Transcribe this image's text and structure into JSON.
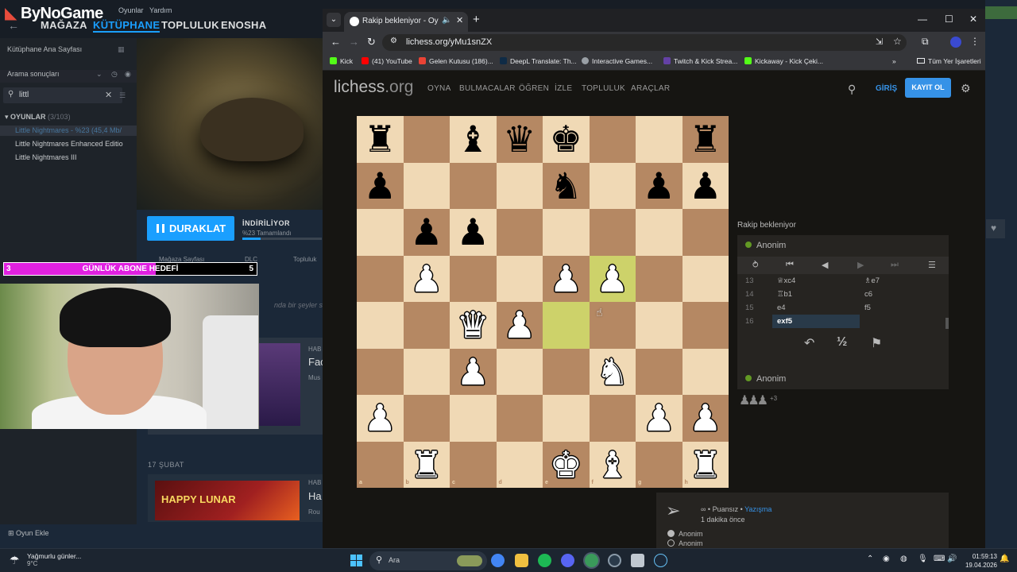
{
  "steam": {
    "logo": "ByNoGame",
    "menu": [
      "Oyunlar",
      "Yardım"
    ],
    "nav": [
      "MAĞAZA",
      "KÜTÜPHANE",
      "TOPLULUK",
      "ENOSHA"
    ],
    "sidebar": {
      "home": "Kütüphane Ana Sayfası",
      "search_label": "Arama sonuçları",
      "search_value": "littl",
      "games_header": "OYUNLAR",
      "games_count": "(3/103)",
      "games": [
        "Little Nightmares - %23 (45,4 Mb/",
        "Little Nightmares Enhanced Editio",
        "Little Nightmares III"
      ],
      "add_game": "Oyun Ekle"
    },
    "pause_label": "DURAKLAT",
    "download_status": "İNDİRİLİYOR",
    "download_sub": "%23 Tamamlandı",
    "download_progress": 0.23,
    "tabs": [
      "Mağaza Sayfası",
      "DLC",
      "Topluluk"
    ],
    "feed_fragment": "nda bir şeyler söylü",
    "date_label": "17 ŞUBAT",
    "news": [
      {
        "tag": "HAB",
        "title": "Fac",
        "sub": "Mus"
      },
      {
        "tag": "HAB",
        "title": "Ha",
        "sub": "Rou"
      }
    ],
    "happy_text": "HAPPY LUNAR"
  },
  "stream_goal": {
    "current": "3",
    "label": "GÜNLÜK ABONE HEDEFİ",
    "target": "5",
    "progress": 0.6
  },
  "browser": {
    "tab_title": "Rakip bekleniyor - Oyna An",
    "url": "lichess.org/yMu1snZX",
    "bookmarks": [
      {
        "label": "Kick",
        "color": "#53fc18"
      },
      {
        "label": "(41) YouTube",
        "color": "#ff0000"
      },
      {
        "label": "Gelen Kutusu (186)...",
        "color": "#ea4335"
      },
      {
        "label": "DeepL Translate: Th...",
        "color": "#0f2b46"
      },
      {
        "label": "Interactive Games...",
        "color": "#9aa0a6"
      },
      {
        "label": "Twitch & Kick Strea...",
        "color": "#6441a5"
      },
      {
        "label": "Kickaway - Kick Çeki...",
        "color": "#53fc18"
      }
    ],
    "bookmarks_more": "»",
    "all_bookmarks": "Tüm Yer İşaretleri"
  },
  "lichess": {
    "logo_main": "lichess",
    "logo_tld": ".org",
    "nav": [
      "OYNA",
      "BULMACALAR",
      "ÖĞREN",
      "İZLE",
      "TOPLULUK",
      "ARAÇLAR"
    ],
    "login": "GİRİŞ",
    "signup": "KAYIT OL",
    "waiting": "Rakip bekleniyor",
    "player_top": "Anonim",
    "player_bottom": "Anonim",
    "moves": [
      {
        "n": "13",
        "w": "♕xc4",
        "b": "♗e7"
      },
      {
        "n": "14",
        "w": "♖b1",
        "b": "c6"
      },
      {
        "n": "15",
        "w": "e4",
        "b": "f5"
      },
      {
        "n": "16",
        "w": "exf5",
        "b": ""
      }
    ],
    "captured": "♟♟♟",
    "captured_count": "+3",
    "chat_meta_prefix": "∞ • Puansız •",
    "chat_meta_link": "Yazışma",
    "chat_time": "1 dakika önce",
    "radio": [
      "Anonim",
      "Anonim"
    ]
  },
  "board": {
    "files": [
      "a",
      "b",
      "c",
      "d",
      "e",
      "f",
      "g",
      "h"
    ],
    "ranks": [
      "8",
      "7",
      "6",
      "5",
      "4",
      "3",
      "2",
      "1"
    ],
    "highlight": [
      "f5",
      "e4"
    ],
    "pieces": [
      {
        "sq": "a8",
        "p": "♜",
        "c": "b"
      },
      {
        "sq": "c8",
        "p": "♝",
        "c": "b"
      },
      {
        "sq": "d8",
        "p": "♛",
        "c": "b"
      },
      {
        "sq": "e8",
        "p": "♚",
        "c": "b"
      },
      {
        "sq": "h8",
        "p": "♜",
        "c": "b"
      },
      {
        "sq": "a7",
        "p": "♟",
        "c": "b"
      },
      {
        "sq": "e7",
        "p": "♞",
        "c": "b"
      },
      {
        "sq": "g7",
        "p": "♟",
        "c": "b"
      },
      {
        "sq": "h7",
        "p": "♟",
        "c": "b"
      },
      {
        "sq": "b6",
        "p": "♟",
        "c": "b"
      },
      {
        "sq": "c6",
        "p": "♟",
        "c": "b"
      },
      {
        "sq": "b5",
        "p": "♟",
        "c": "w"
      },
      {
        "sq": "e5",
        "p": "♟",
        "c": "w"
      },
      {
        "sq": "f5",
        "p": "♟",
        "c": "w"
      },
      {
        "sq": "c4",
        "p": "♛",
        "c": "w"
      },
      {
        "sq": "d4",
        "p": "♟",
        "c": "w"
      },
      {
        "sq": "c3",
        "p": "♟",
        "c": "w"
      },
      {
        "sq": "f3",
        "p": "♞",
        "c": "w"
      },
      {
        "sq": "a2",
        "p": "♟",
        "c": "w"
      },
      {
        "sq": "g2",
        "p": "♟",
        "c": "w"
      },
      {
        "sq": "h2",
        "p": "♟",
        "c": "w"
      },
      {
        "sq": "b1",
        "p": "♜",
        "c": "w"
      },
      {
        "sq": "e1",
        "p": "♚",
        "c": "w"
      },
      {
        "sq": "f1",
        "p": "♝",
        "c": "w"
      },
      {
        "sq": "h1",
        "p": "♜",
        "c": "w"
      }
    ]
  },
  "taskbar": {
    "weather_text": "Yağmurlu günler...",
    "weather_temp": "9°C",
    "search_placeholder": "Ara",
    "time": "01:59:13",
    "date": "19.04.2026"
  }
}
